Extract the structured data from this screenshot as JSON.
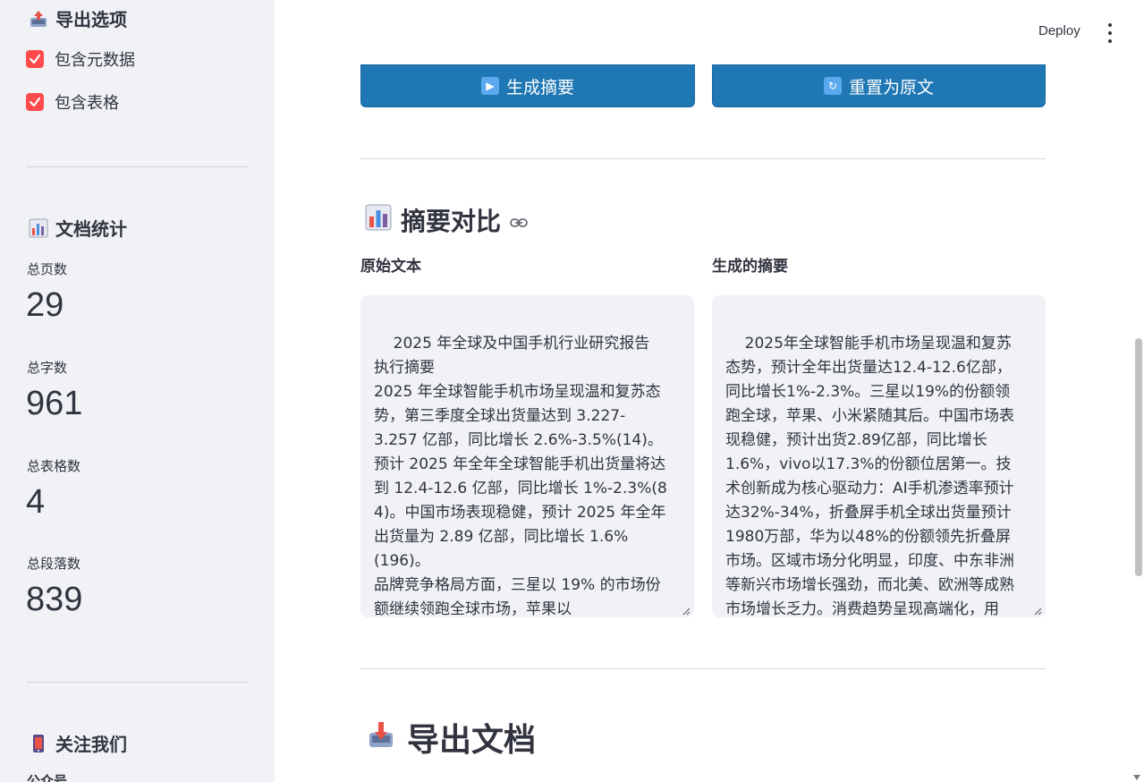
{
  "sidebar": {
    "export_options_title": "导出选项",
    "checkboxes": [
      {
        "label": "包含元数据",
        "checked": true
      },
      {
        "label": "包含表格",
        "checked": true
      }
    ],
    "stats_title": "文档统计",
    "metrics": [
      {
        "label": "总页数",
        "value": "29"
      },
      {
        "label": "总字数",
        "value": "961"
      },
      {
        "label": "总表格数",
        "value": "4"
      },
      {
        "label": "总段落数",
        "value": "839"
      }
    ],
    "follow_title": "关注我们",
    "follow_next": "公众号"
  },
  "topbar": {
    "deploy_label": "Deploy"
  },
  "buttons": {
    "generate_label": "生成摘要",
    "reset_label": "重置为原文"
  },
  "compare": {
    "title": "摘要对比",
    "original_label": "原始文本",
    "summary_label": "生成的摘要",
    "original_text": "2025 年全球及中国手机行业研究报告\n执行摘要\n2025 年全球智能手机市场呈现温和复苏态势，第三季度全球出货量达到 3.227-3.257 亿部，同比增长 2.6%-3.5%(14)。预计 2025 年全年全球智能手机出货量将达到 12.4-12.6 亿部，同比增长 1%-2.3%(8\n4)。中国市场表现稳健，预计 2025 年全年出货量为 2.89 亿部，同比增长 1.6%(196)。\n品牌竞争格局方面，三星以 19% 的市场份额继续领跑全球市场，苹果以",
    "summary_text": "2025年全球智能手机市场呈现温和复苏态势，预计全年出货量达12.4-12.6亿部，同比增长1%-2.3%。三星以19%的份额领跑全球，苹果、小米紧随其后。中国市场表现稳健，预计出货2.89亿部，同比增长1.6%，vivo以17.3%的份额位居第一。技术创新成为核心驱动力：AI手机渗透率预计达32%-34%，折叠屏手机全球出货量预计1980万部，华为以48%的份额领先折叠屏市场。区域市场分化明显，印度、中东非洲等新兴市场增长强劲，而北美、欧洲等成熟市场增长乏力。消费趋势呈现高端化，用"
  },
  "export": {
    "title": "导出文档"
  }
}
